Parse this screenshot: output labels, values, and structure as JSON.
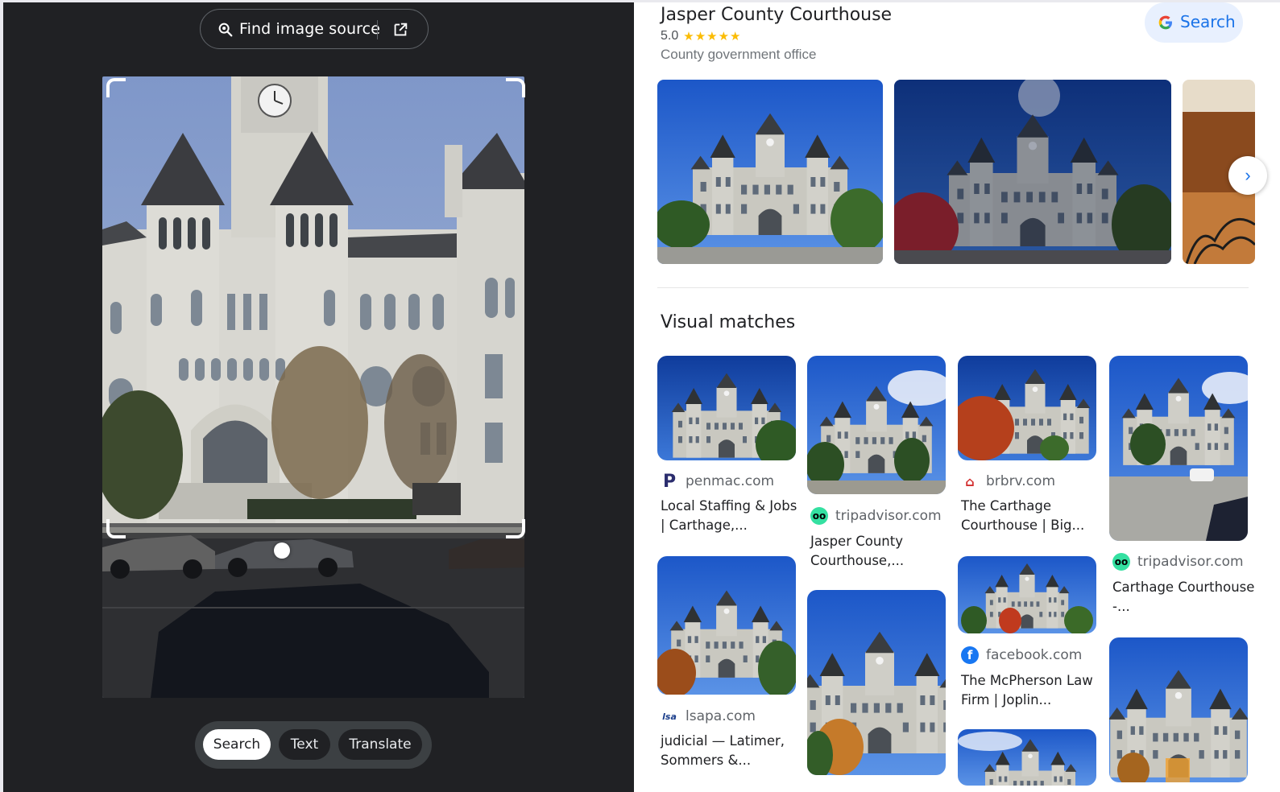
{
  "lens": {
    "find_source_label": "Find image source",
    "modes": [
      {
        "label": "Search",
        "active": true
      },
      {
        "label": "Text",
        "active": false
      },
      {
        "label": "Translate",
        "active": false
      }
    ]
  },
  "knowledge_panel": {
    "title": "Jasper County Courthouse",
    "rating": "5.0",
    "stars": "★★★★★",
    "type": "County government office",
    "search_label": "Search",
    "next_icon": "›"
  },
  "visual_matches": {
    "title": "Visual matches",
    "items": [
      {
        "site": "penmac.com",
        "title": "Local Staffing & Jobs | Carthage,..."
      },
      {
        "site": "tripadvisor.com",
        "title": "Jasper County Courthouse,..."
      },
      {
        "site": "brbrv.com",
        "title": "The Carthage Courthouse | Big..."
      },
      {
        "site": "tripadvisor.com",
        "title": "Carthage Courthouse -..."
      },
      {
        "site": "lsapa.com",
        "title": "judicial — Latimer, Sommers &..."
      },
      {
        "site": "facebook.com",
        "title": "The McPherson Law Firm | Joplin..."
      }
    ]
  },
  "colors": {
    "dark_bg": "#202124",
    "accent_blue": "#1a73e8",
    "star": "#fbbc04",
    "tripadvisor": "#34e0a1",
    "penmac": "#2b2d6e",
    "brbrv": "#d32f2f",
    "facebook": "#1877f2"
  }
}
